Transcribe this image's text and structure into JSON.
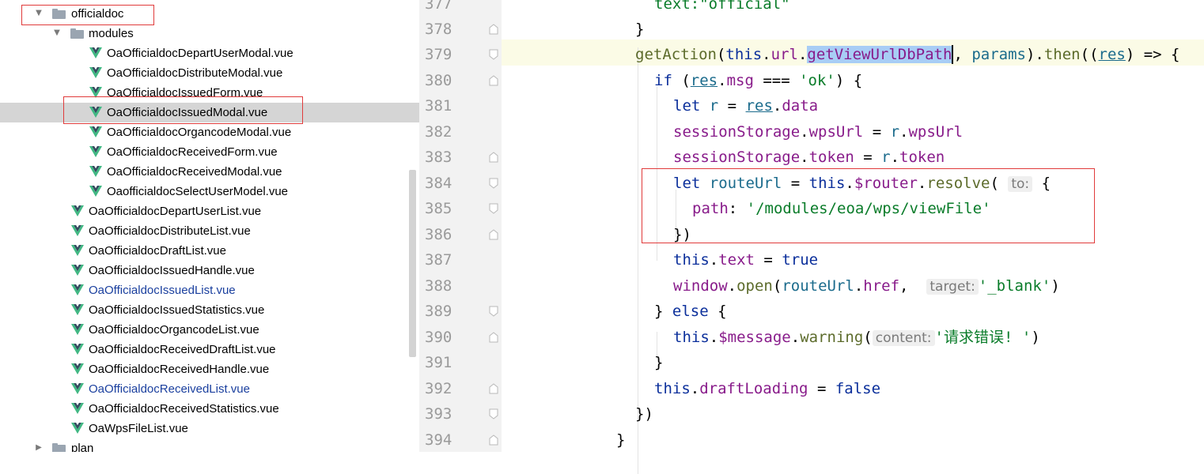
{
  "tree": {
    "items": [
      {
        "label": "officialdoc",
        "type": "folder",
        "expanded": true
      },
      {
        "label": "modules",
        "type": "folder",
        "expanded": true
      },
      {
        "label": "OaOfficialdocDepartUserModal.vue",
        "type": "vue"
      },
      {
        "label": "OaOfficialdocDistributeModal.vue",
        "type": "vue"
      },
      {
        "label": "OaOfficialdocIssuedForm.vue",
        "type": "vue"
      },
      {
        "label": "OaOfficialdocIssuedModal.vue",
        "type": "vue",
        "selected": true
      },
      {
        "label": "OaOfficialdocOrgancodeModal.vue",
        "type": "vue"
      },
      {
        "label": "OaOfficialdocReceivedForm.vue",
        "type": "vue"
      },
      {
        "label": "OaOfficialdocReceivedModal.vue",
        "type": "vue"
      },
      {
        "label": "OaofficialdocSelectUserModel.vue",
        "type": "vue"
      },
      {
        "label": "OaOfficialdocDepartUserList.vue",
        "type": "vue"
      },
      {
        "label": "OaOfficialdocDistributeList.vue",
        "type": "vue"
      },
      {
        "label": "OaOfficialdocDraftList.vue",
        "type": "vue"
      },
      {
        "label": "OaOfficialdocIssuedHandle.vue",
        "type": "vue"
      },
      {
        "label": "OaOfficialdocIssuedList.vue",
        "type": "vue",
        "modified": true
      },
      {
        "label": "OaOfficialdocIssuedStatistics.vue",
        "type": "vue"
      },
      {
        "label": "OaOfficialdocOrgancodeList.vue",
        "type": "vue"
      },
      {
        "label": "OaOfficialdocReceivedDraftList.vue",
        "type": "vue"
      },
      {
        "label": "OaOfficialdocReceivedHandle.vue",
        "type": "vue"
      },
      {
        "label": "OaOfficialdocReceivedList.vue",
        "type": "vue",
        "modified": true
      },
      {
        "label": "OaOfficialdocReceivedStatistics.vue",
        "type": "vue"
      },
      {
        "label": "OaWpsFileList.vue",
        "type": "vue"
      },
      {
        "label": "plan",
        "type": "folder",
        "expanded": false
      }
    ]
  },
  "editor": {
    "line_numbers": [
      "377",
      "378",
      "379",
      "380",
      "381",
      "382",
      "383",
      "384",
      "385",
      "386",
      "387",
      "388",
      "389",
      "390",
      "391",
      "392",
      "393",
      "394"
    ],
    "lines": [
      [
        [
          "str",
          "text:\"official\""
        ]
      ],
      [
        [
          "",
          "}"
        ]
      ],
      [
        [
          "fn",
          "getAction"
        ],
        [
          "",
          "("
        ],
        [
          "kw",
          "this"
        ],
        [
          "",
          "."
        ],
        [
          "prop",
          "url"
        ],
        [
          "",
          "."
        ],
        [
          "prop sel",
          "getViewUrlDbPath"
        ],
        [
          "caret",
          ""
        ],
        [
          "",
          ", "
        ],
        [
          "par",
          "params"
        ],
        [
          "",
          ")."
        ],
        [
          "fn",
          "then"
        ],
        [
          "",
          "(("
        ],
        [
          "par und",
          "res"
        ],
        [
          "",
          ") => {"
        ]
      ],
      [
        [
          "kw",
          "if"
        ],
        [
          "",
          " ("
        ],
        [
          "par und",
          "res"
        ],
        [
          "",
          "."
        ],
        [
          "prop",
          "msg"
        ],
        [
          "",
          " === "
        ],
        [
          "str",
          "'ok'"
        ],
        [
          "",
          ") {"
        ]
      ],
      [
        [
          "kw",
          "let"
        ],
        [
          "",
          " "
        ],
        [
          "var",
          "r"
        ],
        [
          "",
          " = "
        ],
        [
          "par und",
          "res"
        ],
        [
          "",
          "."
        ],
        [
          "prop",
          "data"
        ]
      ],
      [
        [
          "prop",
          "sessionStorage"
        ],
        [
          "",
          "."
        ],
        [
          "prop",
          "wpsUrl"
        ],
        [
          "",
          " = "
        ],
        [
          "var",
          "r"
        ],
        [
          "",
          "."
        ],
        [
          "prop",
          "wpsUrl"
        ]
      ],
      [
        [
          "prop",
          "sessionStorage"
        ],
        [
          "",
          "."
        ],
        [
          "prop",
          "token"
        ],
        [
          "",
          " = "
        ],
        [
          "var",
          "r"
        ],
        [
          "",
          "."
        ],
        [
          "prop",
          "token"
        ]
      ],
      [
        [
          "kw",
          "let"
        ],
        [
          "",
          " "
        ],
        [
          "var",
          "routeUrl"
        ],
        [
          "",
          " = "
        ],
        [
          "kw",
          "this"
        ],
        [
          "",
          "."
        ],
        [
          "prop",
          "$router"
        ],
        [
          "",
          "."
        ],
        [
          "fn",
          "resolve"
        ],
        [
          "",
          "( "
        ],
        [
          "hint",
          "to:"
        ],
        [
          "",
          " {"
        ]
      ],
      [
        [
          "prop",
          "path"
        ],
        [
          "",
          ": "
        ],
        [
          "str",
          "'/modules/eoa/wps/viewFile'"
        ]
      ],
      [
        [
          "",
          "})"
        ]
      ],
      [
        [
          "kw",
          "this"
        ],
        [
          "",
          "."
        ],
        [
          "prop",
          "text"
        ],
        [
          "",
          " = "
        ],
        [
          "kw",
          "true"
        ]
      ],
      [
        [
          "prop",
          "window"
        ],
        [
          "",
          "."
        ],
        [
          "fn",
          "open"
        ],
        [
          "",
          "("
        ],
        [
          "var",
          "routeUrl"
        ],
        [
          "",
          "."
        ],
        [
          "prop",
          "href"
        ],
        [
          "",
          ",  "
        ],
        [
          "hint",
          "target:"
        ],
        [
          "str",
          "'_blank'"
        ],
        [
          "",
          ")"
        ]
      ],
      [
        [
          "",
          "} "
        ],
        [
          "kw",
          "else"
        ],
        [
          "",
          " {"
        ]
      ],
      [
        [
          "kw",
          "this"
        ],
        [
          "",
          "."
        ],
        [
          "prop",
          "$message"
        ],
        [
          "",
          "."
        ],
        [
          "fn",
          "warning"
        ],
        [
          "",
          "("
        ],
        [
          "hint",
          "content:"
        ],
        [
          "str",
          "'请求错误! '"
        ],
        [
          "",
          ")"
        ]
      ],
      [
        [
          "",
          "}"
        ]
      ],
      [
        [
          "kw",
          "this"
        ],
        [
          "",
          "."
        ],
        [
          "prop",
          "draftLoading"
        ],
        [
          "",
          " = "
        ],
        [
          "kw",
          "false"
        ]
      ],
      [
        [
          "",
          "})"
        ]
      ],
      [
        [
          "",
          "}"
        ]
      ]
    ]
  },
  "colors": {
    "keyword": "#0b2f9b",
    "property": "#881b8a",
    "string": "#0a7c2a",
    "function": "#5c6b2b",
    "selection": "#a8cdf5",
    "annotation_box": "#e03b3b"
  }
}
